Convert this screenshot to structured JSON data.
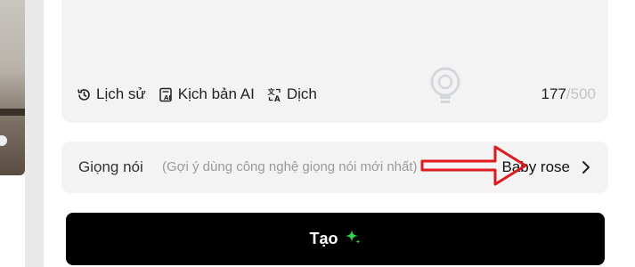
{
  "toolbar": {
    "history_label": "Lịch sử",
    "ai_script_label": "Kịch bản AI",
    "translate_label": "Dịch"
  },
  "counter": {
    "current": "177",
    "separator": "/",
    "max": "500"
  },
  "voice": {
    "label": "Giọng nói",
    "hint": "(Gợi ý dùng công nghệ giọng nói mới nhất)",
    "value": "Baby rose"
  },
  "create_button": {
    "label": "Tạo",
    "sparkle_color": "#2bd64b"
  },
  "annotation_arrow_color": "#e0191d",
  "icons": {
    "history": "history-clock-icon",
    "ai_script": "ai-script-icon",
    "translate": "translate-icon",
    "chevron": "chevron-right-icon",
    "sparkle": "sparkle-icon"
  },
  "watermark": {
    "logo": "quantrimang-logo"
  }
}
